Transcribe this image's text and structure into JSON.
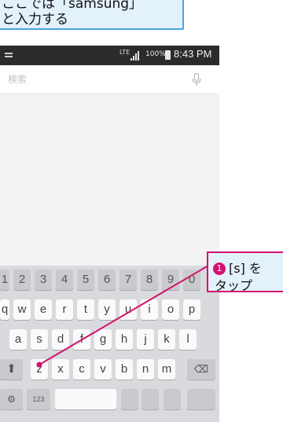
{
  "callout_top": {
    "line1": "ここでは「samsung」",
    "line2": "と入力する"
  },
  "status_bar": {
    "network": "LTE",
    "battery": "100%",
    "time": "8:43 PM"
  },
  "search": {
    "placeholder": "検索",
    "value": ""
  },
  "keyboard": {
    "number_row": [
      "1",
      "2",
      "3",
      "4",
      "5",
      "6",
      "7",
      "8",
      "9",
      "0"
    ],
    "row1": [
      "q",
      "w",
      "e",
      "r",
      "t",
      "y",
      "u",
      "i",
      "o",
      "p"
    ],
    "row2": [
      "a",
      "s",
      "d",
      "f",
      "g",
      "h",
      "j",
      "k",
      "l"
    ],
    "row3": [
      "z",
      "x",
      "c",
      "v",
      "b",
      "n",
      "m"
    ],
    "shift_symbol": "⬆",
    "delete_symbol": "⌫",
    "bottom_row_visible": [
      "⚙",
      "123"
    ]
  },
  "callout_step": {
    "number": "1",
    "line1": "[s] を",
    "line2": "タップ"
  },
  "colors": {
    "callout_blue_border": "#4aa3df",
    "callout_fill": "#e3f1fb",
    "accent_magenta": "#d4116f",
    "status_bar": "#2b2b2b",
    "keyboard_bg": "#d9dadd"
  }
}
